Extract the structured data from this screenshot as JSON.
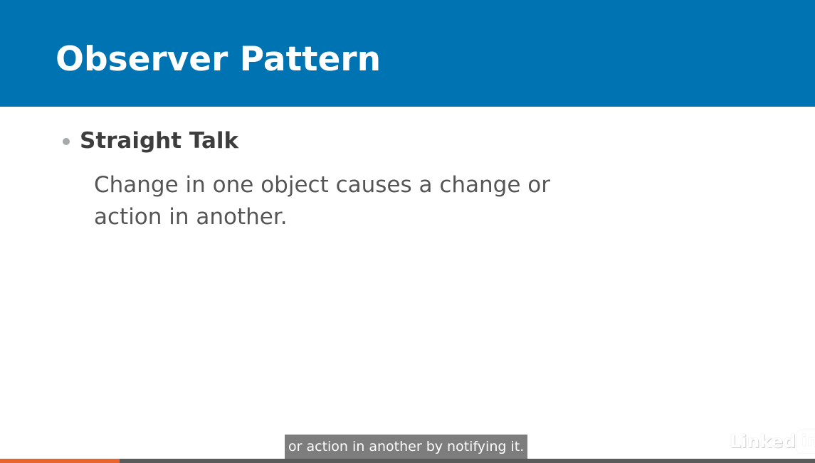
{
  "slide": {
    "title": "Observer Pattern",
    "bullet_heading": "Straight Talk",
    "bullet_body": "Change in one object causes a change or action in another."
  },
  "player": {
    "caption": "or action in another by notifying it.",
    "logo_word": "Linked",
    "logo_box": "in",
    "progress_fraction": 0.147
  },
  "colors": {
    "title_bar": "#0073b3",
    "progress": "#e8662d"
  }
}
